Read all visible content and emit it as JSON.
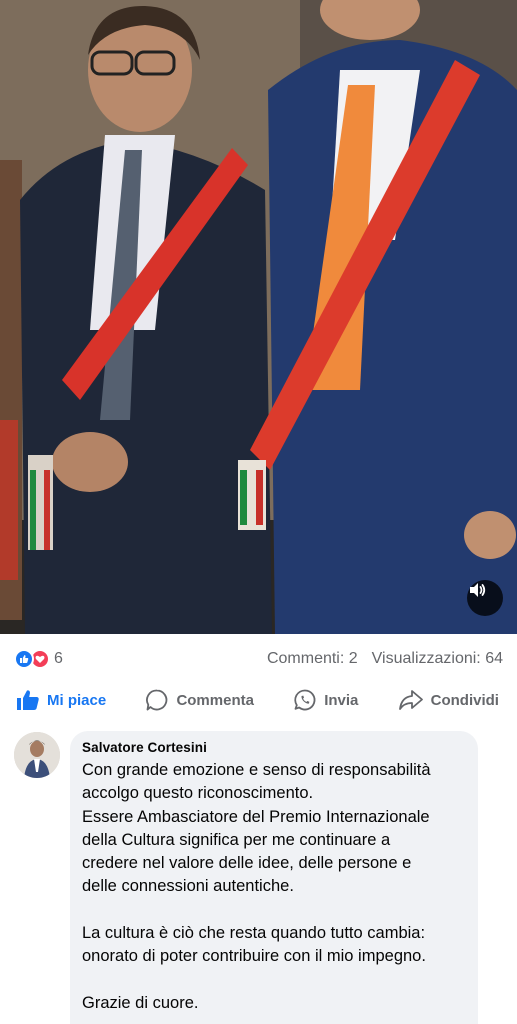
{
  "video": {
    "mute_icon": "speaker-icon"
  },
  "reactions": {
    "icons": [
      "like-icon",
      "love-icon"
    ],
    "count": "6",
    "colors": {
      "like": "#1877f2",
      "love": "#f33e58"
    }
  },
  "stats": {
    "comments": "Commenti: 2",
    "views": "Visualizzazioni: 64"
  },
  "actions": {
    "like": "Mi piace",
    "comment": "Commenta",
    "send": "Invia",
    "share": "Condividi"
  },
  "comment": {
    "author": "Salvatore Cortesini",
    "lines": [
      "Con grande emozione e senso di responsabilità",
      "accolgo questo riconoscimento.",
      "Essere Ambasciatore del Premio Internazionale",
      "della Cultura significa per me continuare a",
      "credere nel valore delle idee, delle persone e",
      "delle connessioni autentiche.",
      "",
      "La cultura è ciò che resta quando tutto cambia:",
      "onorato di poter contribuire con il mio impegno.",
      "",
      "Grazie di cuore."
    ]
  },
  "theme": {
    "accent": "#1877f2",
    "secondary_text": "#65676b",
    "bubble_bg": "#f0f2f5"
  }
}
